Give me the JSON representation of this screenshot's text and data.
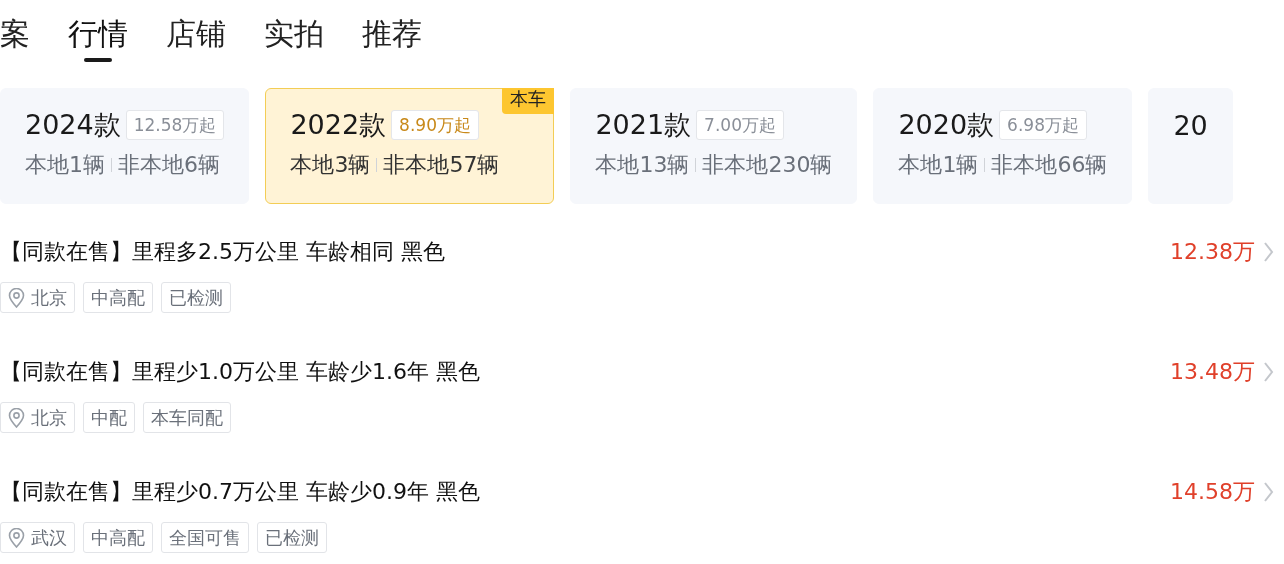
{
  "tabs": [
    {
      "label": "案",
      "selected": false
    },
    {
      "label": "行情",
      "selected": true
    },
    {
      "label": "店铺",
      "selected": false
    },
    {
      "label": "实拍",
      "selected": false
    },
    {
      "label": "推荐",
      "selected": false
    }
  ],
  "year_cards": [
    {
      "year": "2024款",
      "price": "12.58万起",
      "local": "本地1辆",
      "nonlocal": "非本地6辆",
      "selected": false
    },
    {
      "year": "2022款",
      "price": "8.90万起",
      "local": "本地3辆",
      "nonlocal": "非本地57辆",
      "selected": true,
      "badge": "本车"
    },
    {
      "year": "2021款",
      "price": "7.00万起",
      "local": "本地13辆",
      "nonlocal": "非本地230辆",
      "selected": false
    },
    {
      "year": "2020款",
      "price": "6.98万起",
      "local": "本地1辆",
      "nonlocal": "非本地66辆",
      "selected": false
    },
    {
      "year": "20",
      "selected": false
    }
  ],
  "listings": [
    {
      "title": "【同款在售】里程多2.5万公里 车龄相同 黑色",
      "price": "12.38万",
      "tags": [
        {
          "kind": "location",
          "label": "北京"
        },
        {
          "kind": "plain",
          "label": "中高配"
        },
        {
          "kind": "plain",
          "label": "已检测"
        }
      ]
    },
    {
      "title": "【同款在售】里程少1.0万公里 车龄少1.6年 黑色",
      "price": "13.48万",
      "tags": [
        {
          "kind": "location",
          "label": "北京"
        },
        {
          "kind": "plain",
          "label": "中配"
        },
        {
          "kind": "plain",
          "label": "本车同配"
        }
      ]
    },
    {
      "title": "【同款在售】里程少0.7万公里 车龄少0.9年 黑色",
      "price": "14.58万",
      "tags": [
        {
          "kind": "location",
          "label": "武汉"
        },
        {
          "kind": "plain",
          "label": "中高配"
        },
        {
          "kind": "plain",
          "label": "全国可售"
        },
        {
          "kind": "plain",
          "label": "已检测"
        }
      ]
    }
  ]
}
